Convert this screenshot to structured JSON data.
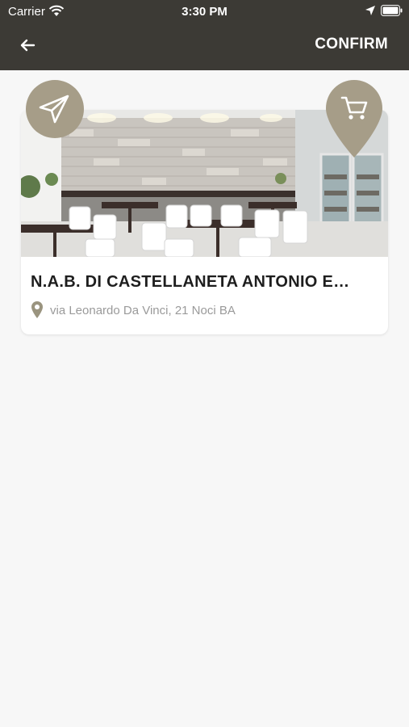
{
  "status_bar": {
    "carrier": "Carrier",
    "time": "3:30 PM"
  },
  "nav": {
    "confirm_label": "CONFIRM"
  },
  "store": {
    "name": "N.A.B. DI CASTELLANETA ANTONIO E…",
    "address": "via Leonardo Da Vinci, 21 Noci BA"
  },
  "colors": {
    "header_bg": "#3c3a35",
    "accent_badge": "#a69d88",
    "pin_icon": "#9a947f",
    "background": "#f7f7f7"
  },
  "icons": {
    "back": "arrow-left-icon",
    "send": "paper-plane-icon",
    "cart": "shopping-cart-icon",
    "location": "map-pin-icon"
  }
}
